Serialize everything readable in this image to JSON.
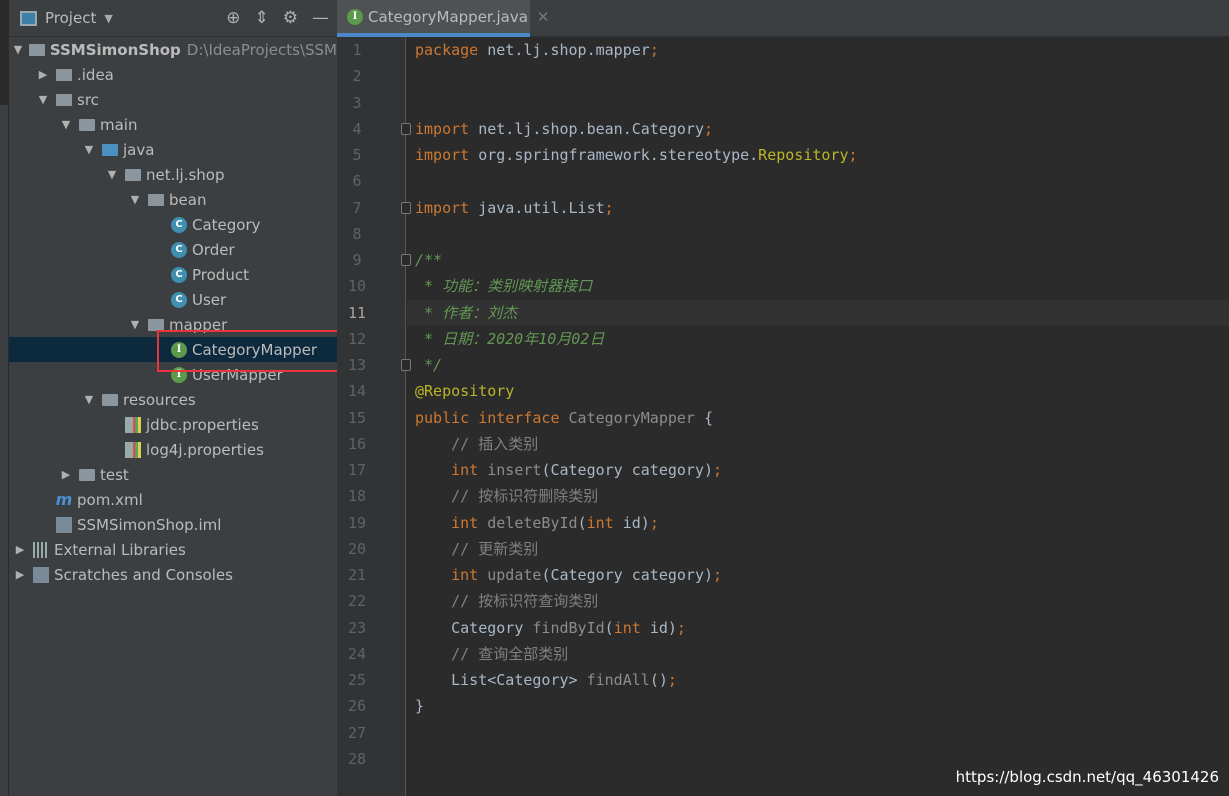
{
  "sidebar": {
    "title": "Project",
    "tools": [
      "locate-icon",
      "collapse-icon",
      "gear-icon",
      "minimize-icon"
    ],
    "tree": [
      {
        "label": "SSMSimonShop",
        "path": "D:\\IdeaProjects\\SSM",
        "depth": 0,
        "arrow": "down",
        "icon": "module",
        "bold": true
      },
      {
        "label": ".idea",
        "depth": 1,
        "arrow": "right",
        "icon": "folder"
      },
      {
        "label": "src",
        "depth": 1,
        "arrow": "down",
        "icon": "folder"
      },
      {
        "label": "main",
        "depth": 2,
        "arrow": "down",
        "icon": "folder"
      },
      {
        "label": "java",
        "depth": 3,
        "arrow": "down",
        "icon": "folder-blue"
      },
      {
        "label": "net.lj.shop",
        "depth": 4,
        "arrow": "down",
        "icon": "package"
      },
      {
        "label": "bean",
        "depth": 5,
        "arrow": "down",
        "icon": "package"
      },
      {
        "label": "Category",
        "depth": 6,
        "icon": "class"
      },
      {
        "label": "Order",
        "depth": 6,
        "icon": "class"
      },
      {
        "label": "Product",
        "depth": 6,
        "icon": "class"
      },
      {
        "label": "User",
        "depth": 6,
        "icon": "class"
      },
      {
        "label": "mapper",
        "depth": 5,
        "arrow": "down",
        "icon": "package"
      },
      {
        "label": "CategoryMapper",
        "depth": 6,
        "icon": "interface",
        "selected": true
      },
      {
        "label": "UserMapper",
        "depth": 6,
        "icon": "interface"
      },
      {
        "label": "resources",
        "depth": 3,
        "arrow": "down",
        "icon": "resources"
      },
      {
        "label": "jdbc.properties",
        "depth": 4,
        "icon": "properties"
      },
      {
        "label": "log4j.properties",
        "depth": 4,
        "icon": "properties"
      },
      {
        "label": "test",
        "depth": 2,
        "arrow": "right",
        "icon": "folder"
      },
      {
        "label": "pom.xml",
        "depth": 1,
        "icon": "maven"
      },
      {
        "label": "SSMSimonShop.iml",
        "depth": 1,
        "icon": "iml"
      },
      {
        "label": "External Libraries",
        "depth": 0,
        "arrow": "right",
        "icon": "library"
      },
      {
        "label": "Scratches and Consoles",
        "depth": 0,
        "arrow": "right",
        "icon": "scratches"
      }
    ]
  },
  "editor": {
    "tab": {
      "label": "CategoryMapper.java",
      "icon": "interface-icon"
    },
    "current_line": 11,
    "lines": [
      [
        [
          "package",
          "kw"
        ],
        [
          " net.lj.shop.mapper",
          "pl"
        ],
        [
          ";",
          "kw"
        ]
      ],
      [],
      [],
      [
        [
          "import",
          "kw"
        ],
        [
          " net.lj.shop.bean.Category",
          "pl"
        ],
        [
          ";",
          "kw"
        ]
      ],
      [
        [
          "import",
          "kw"
        ],
        [
          " org.springframework.stereotype.",
          "pl"
        ],
        [
          "Repository",
          "an"
        ],
        [
          ";",
          "kw"
        ]
      ],
      [],
      [
        [
          "import",
          "kw"
        ],
        [
          " java.util.List",
          "pl"
        ],
        [
          ";",
          "kw"
        ]
      ],
      [],
      [
        [
          "/**",
          "doc"
        ]
      ],
      [
        [
          " * 功能：类别映射器接口",
          "doc"
        ]
      ],
      [
        [
          " * 作者：刘杰",
          "doc"
        ]
      ],
      [
        [
          " * 日期：2020年10月02日",
          "doc"
        ]
      ],
      [
        [
          " */",
          "doc"
        ]
      ],
      [
        [
          "@Repository",
          "an"
        ]
      ],
      [
        [
          "public interface ",
          "kw"
        ],
        [
          "CategoryMapper",
          "un"
        ],
        [
          " {",
          "pl"
        ]
      ],
      [
        [
          "    // 插入类别",
          "cm"
        ]
      ],
      [
        [
          "    int ",
          "kw"
        ],
        [
          "insert",
          "un"
        ],
        [
          "(Category category)",
          "pl"
        ],
        [
          ";",
          "kw"
        ]
      ],
      [
        [
          "    // 按标识符删除类别",
          "cm"
        ]
      ],
      [
        [
          "    int ",
          "kw"
        ],
        [
          "deleteById",
          "un"
        ],
        [
          "(",
          "pl"
        ],
        [
          "int ",
          "kw"
        ],
        [
          "id)",
          "pl"
        ],
        [
          ";",
          "kw"
        ]
      ],
      [
        [
          "    // 更新类别",
          "cm"
        ]
      ],
      [
        [
          "    int ",
          "kw"
        ],
        [
          "update",
          "un"
        ],
        [
          "(Category category)",
          "pl"
        ],
        [
          ";",
          "kw"
        ]
      ],
      [
        [
          "    // 按标识符查询类别",
          "cm"
        ]
      ],
      [
        [
          "    Category ",
          "pl"
        ],
        [
          "findById",
          "un"
        ],
        [
          "(",
          "pl"
        ],
        [
          "int ",
          "kw"
        ],
        [
          "id)",
          "pl"
        ],
        [
          ";",
          "kw"
        ]
      ],
      [
        [
          "    // 查询全部类别",
          "cm"
        ]
      ],
      [
        [
          "    List<Category> ",
          "pl"
        ],
        [
          "findAll",
          "un"
        ],
        [
          "()",
          "pl"
        ],
        [
          ";",
          "kw"
        ]
      ],
      [
        [
          "}",
          "pl"
        ]
      ],
      [],
      []
    ]
  },
  "watermark": "https://blog.csdn.net/qq_46301426"
}
